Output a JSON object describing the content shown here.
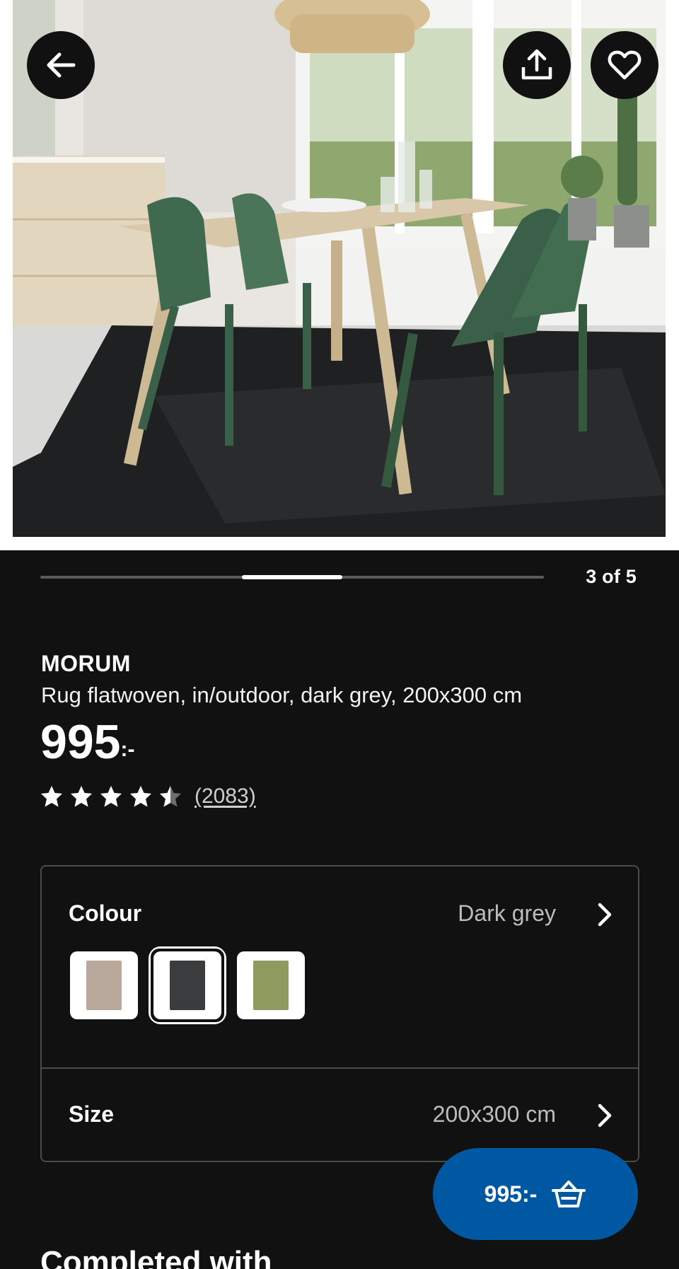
{
  "header": {
    "back_icon": "arrow-left-icon",
    "share_icon": "share-icon",
    "favourite_icon": "heart-icon"
  },
  "gallery": {
    "counter": "3 of 5",
    "current": 3,
    "total": 5
  },
  "product": {
    "name": "MORUM",
    "description": "Rug flatwoven, in/outdoor, dark grey, 200x300 cm",
    "price": "995",
    "price_suffix": ":-",
    "rating": 4.5,
    "rating_max": 5,
    "review_count": "(2083)"
  },
  "options": {
    "colour": {
      "label": "Colour",
      "value": "Dark grey",
      "swatches": [
        {
          "color": "#b8a99c",
          "selected": false
        },
        {
          "color": "#3b3c3e",
          "selected": true
        },
        {
          "color": "#8e9a5e",
          "selected": false
        }
      ]
    },
    "size": {
      "label": "Size",
      "value": "200x300 cm"
    }
  },
  "cart": {
    "price": "995:-",
    "icon": "basket-icon",
    "color": "#0058a3"
  },
  "sections": {
    "completed_with": "Completed with"
  }
}
